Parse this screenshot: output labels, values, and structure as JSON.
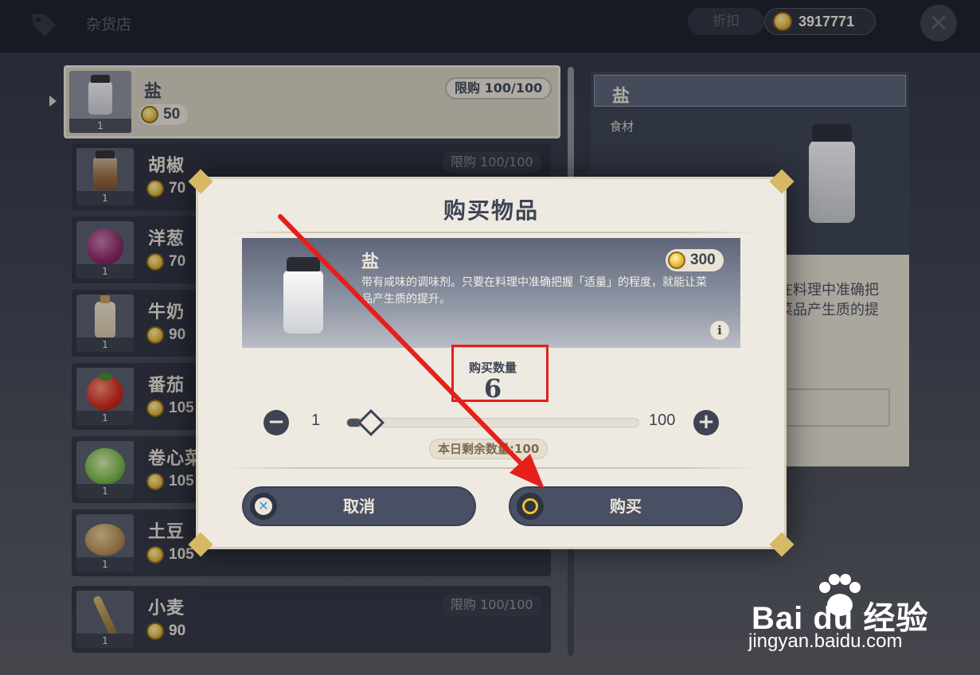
{
  "topbar": {
    "shop_title": "杂货店",
    "discount_label": "折扣",
    "coins": "3917771"
  },
  "items": [
    {
      "name": "盐",
      "price": "50",
      "limit": "限购 100/100",
      "count": "1",
      "art": "salt-jar"
    },
    {
      "name": "胡椒",
      "price": "70",
      "limit": "限购 100/100",
      "count": "1",
      "art": "pepper-jar"
    },
    {
      "name": "洋葱",
      "price": "70",
      "limit": "",
      "count": "1",
      "art": "onion"
    },
    {
      "name": "牛奶",
      "price": "90",
      "limit": "",
      "count": "1",
      "art": "milk-bottle"
    },
    {
      "name": "番茄",
      "price": "105",
      "limit": "",
      "count": "1",
      "art": "tomato"
    },
    {
      "name": "卷心菜",
      "price": "105",
      "limit": "",
      "count": "1",
      "art": "cabbage"
    },
    {
      "name": "土豆",
      "price": "105",
      "limit": "",
      "count": "1",
      "art": "potato"
    },
    {
      "name": "小麦",
      "price": "90",
      "limit": "限购 100/100",
      "count": "1",
      "art": "wheat"
    }
  ],
  "detail": {
    "name": "盐",
    "type": "食材",
    "desc_line1": "在料理中准确把",
    "desc_line2": "菜品产生质的提"
  },
  "dialog": {
    "title": "购买物品",
    "item_name": "盐",
    "item_price": "300",
    "item_desc": "带有咸味的调味剂。只要在料理中准确把握「适量」的程度，就能让菜品产生质的提升。",
    "qty_label": "购买数量",
    "qty_value": "6",
    "min": "1",
    "max": "100",
    "slider_fraction": 0.05,
    "remaining": "本日剩余数量:100",
    "cancel_label": "取消",
    "buy_label": "购买"
  },
  "watermark": {
    "brand": "Bai du 经验",
    "url": "jingyan.baidu.com"
  },
  "colors": {
    "annotation": "#e5201c",
    "coin": "#f0c74b",
    "panel_dark": "#3e4452",
    "panel_light": "#eeeae2"
  }
}
